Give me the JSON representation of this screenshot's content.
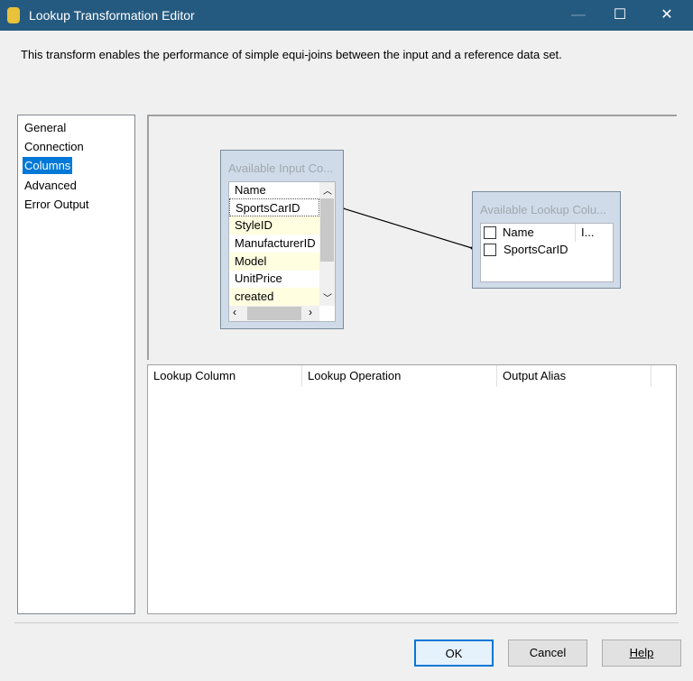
{
  "window": {
    "title": "Lookup Transformation Editor",
    "minimize": "—",
    "maximize": "☐",
    "close": "✕"
  },
  "description": "This transform enables the performance of simple equi-joins between the input and a reference data set.",
  "nav": {
    "items": [
      "General",
      "Connection",
      "Columns",
      "Advanced",
      "Error Output"
    ],
    "selected": "Columns"
  },
  "input_box": {
    "caption": "Available Input Co...",
    "header": "Name",
    "rows": [
      "SportsCarID",
      "StyleID",
      "ManufacturerID",
      "Model",
      "UnitPrice",
      "created"
    ]
  },
  "lookup_box": {
    "caption": "Available Lookup Colu...",
    "header_name": "Name",
    "header_index": "I...",
    "rows": [
      "SportsCarID"
    ]
  },
  "grid": {
    "columns": [
      "Lookup Column",
      "Lookup Operation",
      "Output Alias"
    ]
  },
  "buttons": {
    "ok": "OK",
    "cancel": "Cancel",
    "help": "Help"
  }
}
